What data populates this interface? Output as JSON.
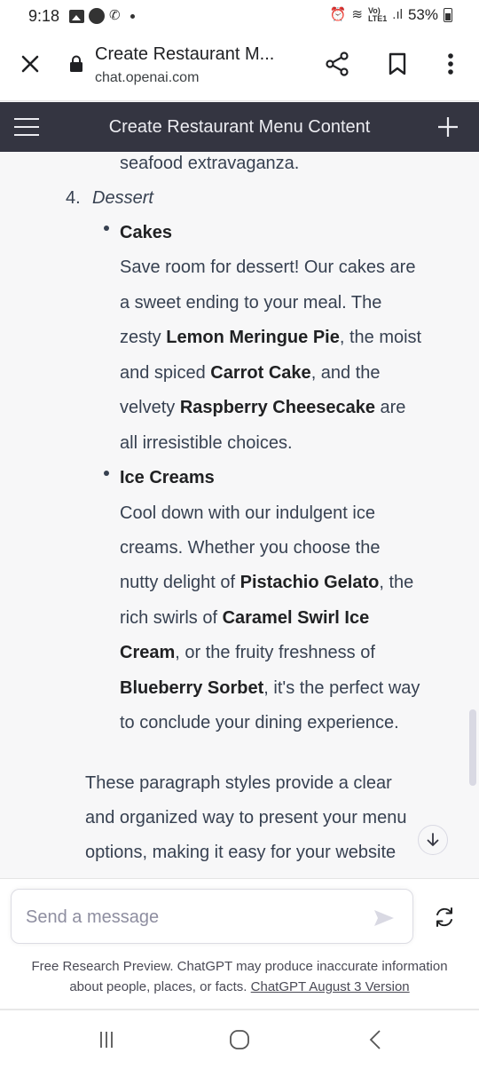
{
  "status_bar": {
    "time": "9:18",
    "network_label": "Vo)",
    "network_sub": "LTE1",
    "battery": "53%"
  },
  "browser": {
    "page_title": "Create Restaurant M...",
    "host": "chat.openai.com",
    "icons": [
      "close-icon",
      "lock-icon",
      "share-icon",
      "bookmark-icon",
      "more-vert-icon"
    ]
  },
  "chat_header": {
    "title": "Create Restaurant Menu Content"
  },
  "message": {
    "prev_line": "seafood extravaganza.",
    "section_number": "4.",
    "section_title": "Dessert",
    "cakes": {
      "heading": "Cakes",
      "line1": "Save room for dessert! Our cakes are",
      "line2": "a sweet ending to your meal. The",
      "line3_pre": "zesty ",
      "line3_bold": "Lemon Meringue Pie",
      "line3_post": ", the moist",
      "line4_pre": "and spiced ",
      "line4_bold": "Carrot Cake",
      "line4_post": ", and the",
      "line5_pre": "velvety ",
      "line5_bold": "Raspberry Cheesecake",
      "line5_post": " are",
      "line6": "all irresistible choices."
    },
    "ice_creams": {
      "heading": "Ice Creams",
      "line1": "Cool down with our indulgent ice",
      "line2": "creams. Whether you choose the",
      "line3_pre": "nutty delight of ",
      "line3_bold": "Pistachio Gelato",
      "line3_post": ", the",
      "line4_pre": "rich swirls of ",
      "line4_bold": "Caramel Swirl Ice",
      "line5_bold": "Cream",
      "line5_post": ", or the fruity freshness of",
      "line6_bold": "Blueberry Sorbet",
      "line6_post": ", it's the perfect way",
      "line7": "to conclude your dining experience."
    },
    "closing": {
      "line1": "These paragraph styles provide a clear",
      "line2": "and organized way to present your menu",
      "line3": "options, making it easy for your website"
    }
  },
  "composer": {
    "placeholder": "Send a message",
    "disclaimer_line1": "Free Research Preview. ChatGPT may produce inaccurate information",
    "disclaimer_line2": "about people, places, or facts.",
    "version_link": "ChatGPT August 3 Version"
  },
  "colors": {
    "header_bg": "#343541",
    "page_bg": "#f7f7f8",
    "text": "#374151"
  }
}
